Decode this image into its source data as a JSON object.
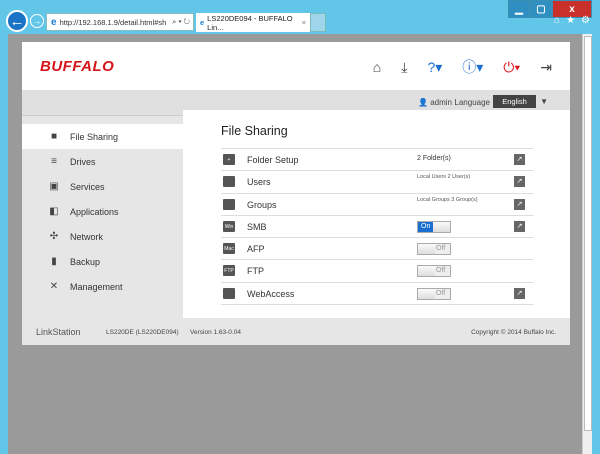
{
  "browser": {
    "url": "http://192.168.1.9/detail.html#sh",
    "tab_title": "LS220DE094 - BUFFALO Lin...",
    "minimize": "▁",
    "maximize": "▢",
    "close": "x"
  },
  "header": {
    "logo": "BUFFALO",
    "user": "admin",
    "language_label": "Language",
    "language": "English"
  },
  "sidebar": {
    "items": [
      {
        "label": "File Sharing",
        "icon": "folder-icon"
      },
      {
        "label": "Drives",
        "icon": "drive-icon"
      },
      {
        "label": "Services",
        "icon": "services-icon"
      },
      {
        "label": "Applications",
        "icon": "applications-icon"
      },
      {
        "label": "Network",
        "icon": "network-icon"
      },
      {
        "label": "Backup",
        "icon": "backup-icon"
      },
      {
        "label": "Management",
        "icon": "tools-icon"
      }
    ]
  },
  "main": {
    "title": "File Sharing",
    "rows": [
      {
        "label": "Folder Setup",
        "value": "2 Folder(s)"
      },
      {
        "label": "Users",
        "value": "Local Users 2 User(s)"
      },
      {
        "label": "Groups",
        "value": "Local Groups 3 Group(s)"
      },
      {
        "label": "SMB",
        "toggle": "On",
        "icon_text": "Win"
      },
      {
        "label": "AFP",
        "toggle": "Off",
        "icon_text": "Mac"
      },
      {
        "label": "FTP",
        "toggle": "Off",
        "icon_text": "FTP"
      },
      {
        "label": "WebAccess",
        "toggle": "Off"
      }
    ]
  },
  "footer": {
    "brand": "LinkStation",
    "model": "LS220DE (LS220DE094)",
    "version": "Version 1.63-0.04",
    "copyright": "Copyright © 2014 Buffalo Inc."
  }
}
